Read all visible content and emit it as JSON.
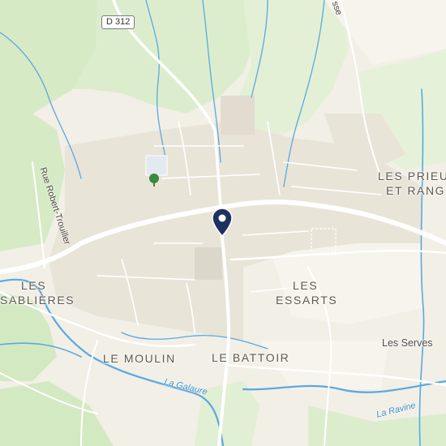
{
  "map": {
    "road_shield": "D 312",
    "place_labels": {
      "les_sablieres_line1": "LES",
      "les_sablieres_line2": "SABLIÈRES",
      "les_prieurs_line1": "LES PRIEU",
      "les_prieurs_line2": "ET RANG",
      "les_essarts_line1": "LES",
      "les_essarts_line2": "ESSARTS",
      "le_moulin": "LE MOULIN",
      "le_battoir": "LE BATTOIR",
      "les_serves": "Les Serves"
    },
    "street_labels": {
      "rue_robert_trouiller": "Rue Robert-Trouiller",
      "road_fragment_top": "sse"
    },
    "waterway_labels": {
      "la_galaure": "La Galaure",
      "la_ravine": "La Ravine"
    },
    "icons": {
      "location_pin": "location-pin-icon",
      "park": "tree-icon"
    },
    "colors": {
      "land": "#f1efe6",
      "forest": "#d7ebc8",
      "water": "#5aa9e0",
      "road": "#ffffff",
      "pin": "#1f3160"
    }
  }
}
